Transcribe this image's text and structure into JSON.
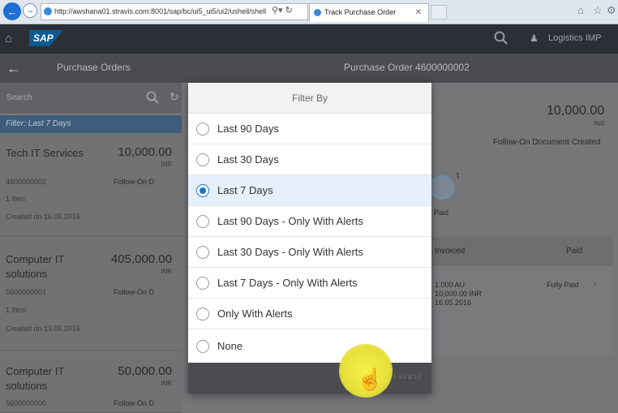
{
  "browser": {
    "url": "http://awshana01.stravis.com:8001/sap/bc/ui5_ui5/ui2/ushell/shell",
    "tab_title": "Track Purchase Order"
  },
  "shell": {
    "logo": "SAP",
    "user": "Logistics IMP"
  },
  "master": {
    "title": "Purchase Orders",
    "search_placeholder": "Search",
    "filter_text": "Filter: Last 7 Days",
    "items": [
      {
        "name": "Tech IT Services",
        "amount": "10,000.00",
        "currency": "INR",
        "number": "4600000002",
        "status": "Follow-On D",
        "count": "1 Item",
        "created": "Created on 16.05.2016"
      },
      {
        "name": "Computer IT solutions",
        "amount": "405,000.00",
        "currency": "INR",
        "number": "5600000001",
        "status": "Follow-On D",
        "count": "1 Item",
        "created": "Created on 13.05.2016"
      },
      {
        "name": "Computer IT solutions",
        "amount": "50,000.00",
        "currency": "INR",
        "number": "5600000000",
        "status": "Follow-On D"
      }
    ]
  },
  "detail": {
    "title": "Purchase Order 4600000002",
    "amount": "10,000.00",
    "currency": "INR",
    "status": "Follow-On Document Created",
    "paid_badge": "1",
    "paid_label": "Paid",
    "col_invoiced": "Invoiced",
    "col_paid": "Paid",
    "row_qty": "1.000 AU",
    "row_amount": "10,000.00 INR",
    "row_date": "16.05.2016",
    "row_paid": "Fully Paid"
  },
  "dialog": {
    "title": "Filter By",
    "options": [
      "Last 90 Days",
      "Last 30 Days",
      "Last 7 Days",
      "Last 90 Days - Only With Alerts",
      "Last 30 Days - Only With Alerts",
      "Last 7 Days - Only With Alerts",
      "Only With Alerts",
      "None"
    ],
    "selected": "Last 7 Days",
    "cancel_label": "Cancel"
  }
}
